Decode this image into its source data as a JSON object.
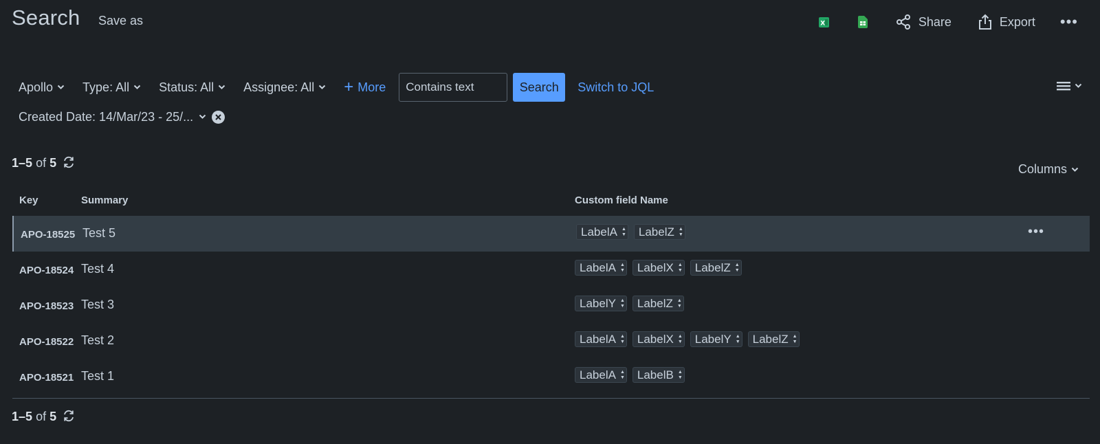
{
  "header": {
    "title": "Search",
    "save_as": "Save as",
    "share": "Share",
    "export": "Export",
    "colors": {
      "excel": "#22a565",
      "sheets": "#34a853"
    }
  },
  "filters": {
    "project": "Apollo",
    "type": "Type: All",
    "status": "Status: All",
    "assignee": "Assignee: All",
    "more": "More",
    "text_placeholder": "Contains text",
    "search_button": "Search",
    "switch_jql": "Switch to JQL",
    "created_date": "Created Date: 14/Mar/23 - 25/..."
  },
  "results": {
    "range": "1–5",
    "of": "of",
    "total": "5",
    "columns_label": "Columns"
  },
  "table": {
    "headers": {
      "key": "Key",
      "summary": "Summary",
      "custom": "Custom field Name"
    },
    "rows": [
      {
        "key": "APO-18525",
        "summary": "Test 5",
        "labels": [
          "LabelA",
          "LabelZ"
        ]
      },
      {
        "key": "APO-18524",
        "summary": "Test 4",
        "labels": [
          "LabelA",
          "LabelX",
          "LabelZ"
        ]
      },
      {
        "key": "APO-18523",
        "summary": "Test 3",
        "labels": [
          "LabelY",
          "LabelZ"
        ]
      },
      {
        "key": "APO-18522",
        "summary": "Test 2",
        "labels": [
          "LabelA",
          "LabelX",
          "LabelY",
          "LabelZ"
        ]
      },
      {
        "key": "APO-18521",
        "summary": "Test 1",
        "labels": [
          "LabelA",
          "LabelB"
        ]
      }
    ]
  },
  "theme": {
    "accent": "#579dff",
    "background": "#1d2125",
    "selected_row": "#333d45"
  }
}
